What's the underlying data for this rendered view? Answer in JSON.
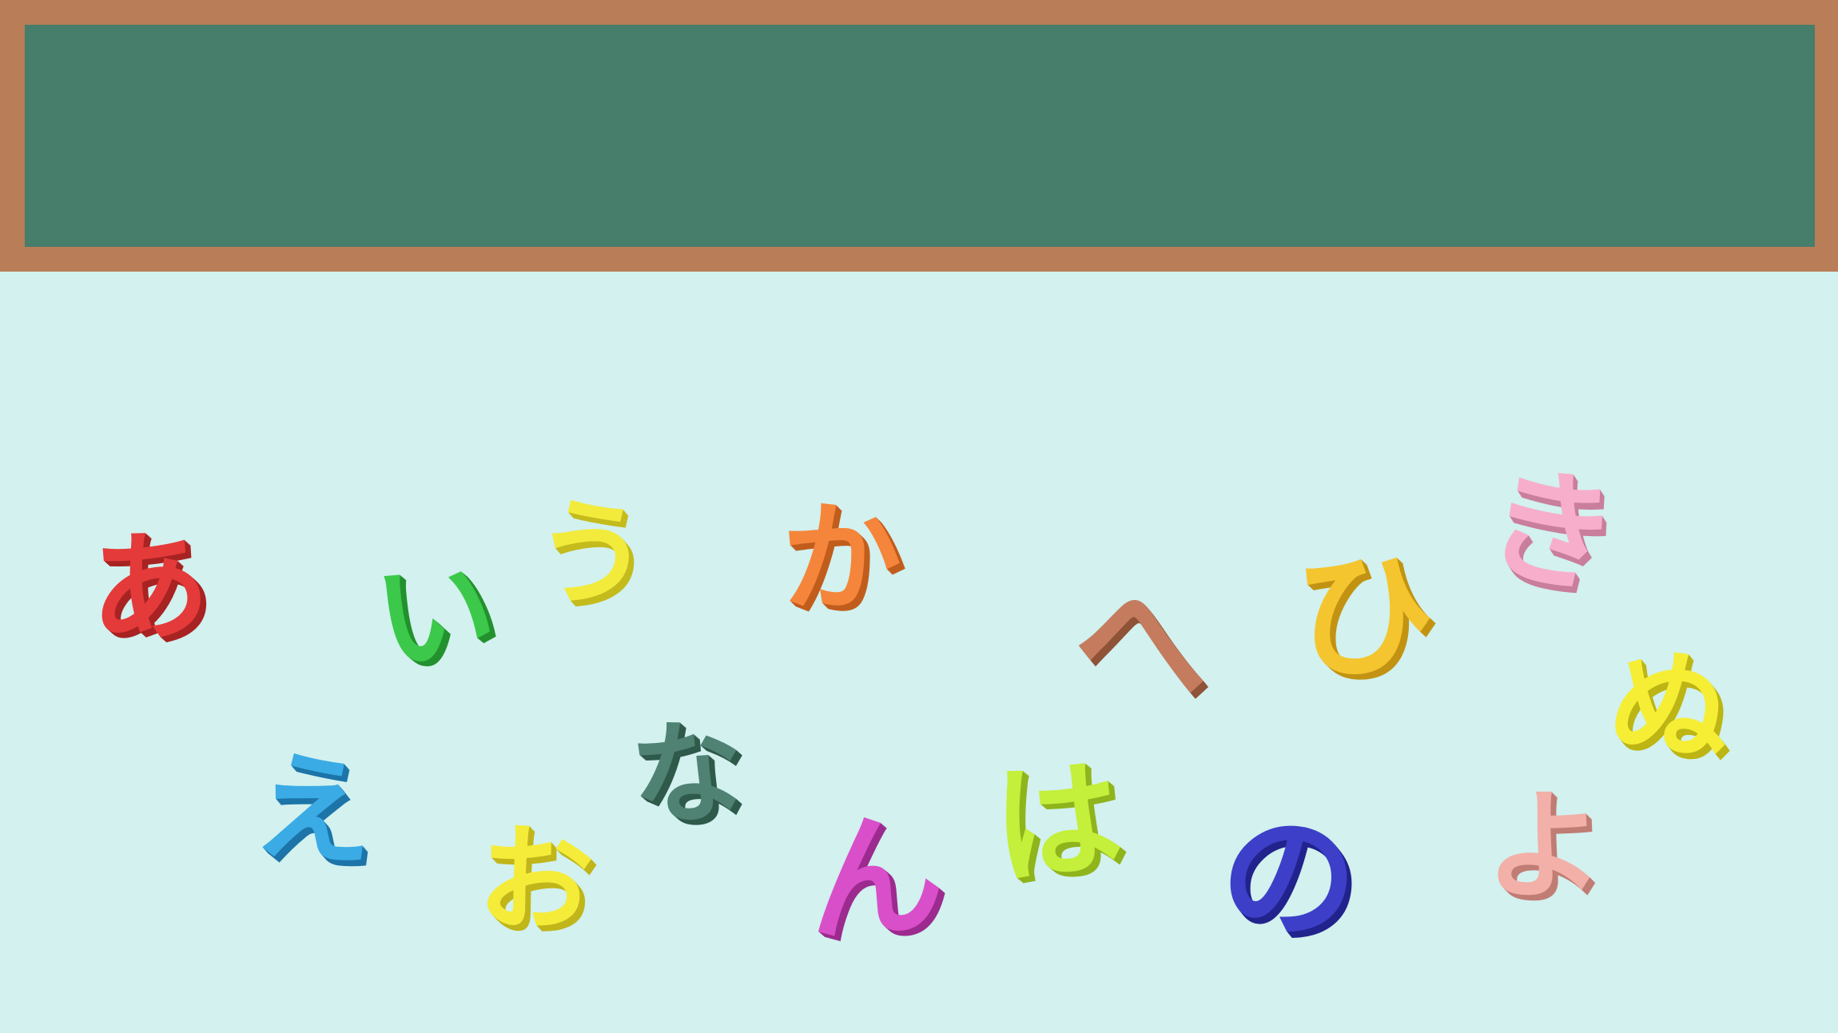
{
  "blackboard": {
    "frame_color": "#b97d58",
    "surface_color": "#467d6b"
  },
  "background_color": "#d2f1ef",
  "letters": [
    {
      "char": "あ",
      "color": "#e43a3a",
      "shade": "#a82323"
    },
    {
      "char": "い",
      "color": "#3cc84a",
      "shade": "#23912e"
    },
    {
      "char": "う",
      "color": "#f3eb3c",
      "shade": "#c4bb1c"
    },
    {
      "char": "か",
      "color": "#f5853a",
      "shade": "#c15d1c"
    },
    {
      "char": "へ",
      "color": "#c57c5e",
      "shade": "#8f5338"
    },
    {
      "char": "ひ",
      "color": "#f4c52e",
      "shade": "#c29312"
    },
    {
      "char": "き",
      "color": "#f7aecb",
      "shade": "#c97e9c"
    },
    {
      "char": "ぬ",
      "color": "#f5ee35",
      "shade": "#bdb514"
    },
    {
      "char": "え",
      "color": "#3aabe4",
      "shade": "#1d74a8"
    },
    {
      "char": "お",
      "color": "#f5ec3a",
      "shade": "#c0b61a"
    },
    {
      "char": "な",
      "color": "#4f8272",
      "shade": "#2f5a4b"
    },
    {
      "char": "ん",
      "color": "#d94fc9",
      "shade": "#9c2b8f"
    },
    {
      "char": "は",
      "color": "#c4ef3a",
      "shade": "#8fb41c"
    },
    {
      "char": "の",
      "color": "#3d3fc8",
      "shade": "#22238d"
    },
    {
      "char": "よ",
      "color": "#f2b0a8",
      "shade": "#c07d74"
    }
  ]
}
